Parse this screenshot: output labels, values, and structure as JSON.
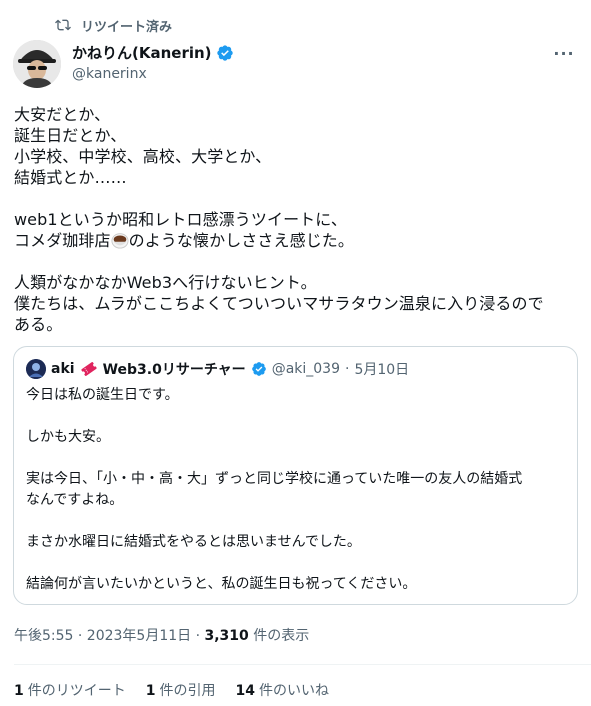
{
  "retweet": {
    "label": "リツイート済み"
  },
  "author": {
    "name": "かねりん(Kanerin)",
    "handle": "@kanerinx"
  },
  "tweet": {
    "lines": [
      "大安だとか、",
      "誕生日だとか、",
      "小学校、中学校、高校、大学とか、",
      "結婚式とか……",
      "",
      "web1というか昭和レトロ感漂うツイートに、",
      "コメダ珈琲店",
      "のような懐かしささえ感じた。",
      "",
      "人類がなかなかWeb3へ行けないヒント。",
      "僕たちは、ムラがここちよくてついついマサラタウン温泉に入り浸るので",
      "ある。"
    ]
  },
  "quote": {
    "name": "aki",
    "name_rest": "Web3.0リサーチャー",
    "handle": "@aki_039",
    "dot": "·",
    "date": "5月10日",
    "lines": [
      "今日は私の誕生日です。",
      "",
      "しかも大安。",
      "",
      "実は今日、「小・中・高・大」ずっと同じ学校に通っていた唯一の友人の結婚式",
      "なんですよね。",
      "",
      "まさか水曜日に結婚式をやるとは思いませんでした。",
      "",
      "結論何が言いたいかというと、私の誕生日も祝ってください。"
    ]
  },
  "timestamp": {
    "time_date": "午後5:55 · 2023年5月11日 · ",
    "views": "3,310",
    "views_label": " 件の表示"
  },
  "stats": {
    "retweets": "1",
    "retweets_label": "件のリツイート",
    "quotes": "1",
    "quotes_label": "件の引用",
    "likes": "14",
    "likes_label": "件のいいね"
  },
  "colors": {
    "verified": "#1d9bf0",
    "secondary_text": "#536471",
    "border": "#cfd9de"
  }
}
